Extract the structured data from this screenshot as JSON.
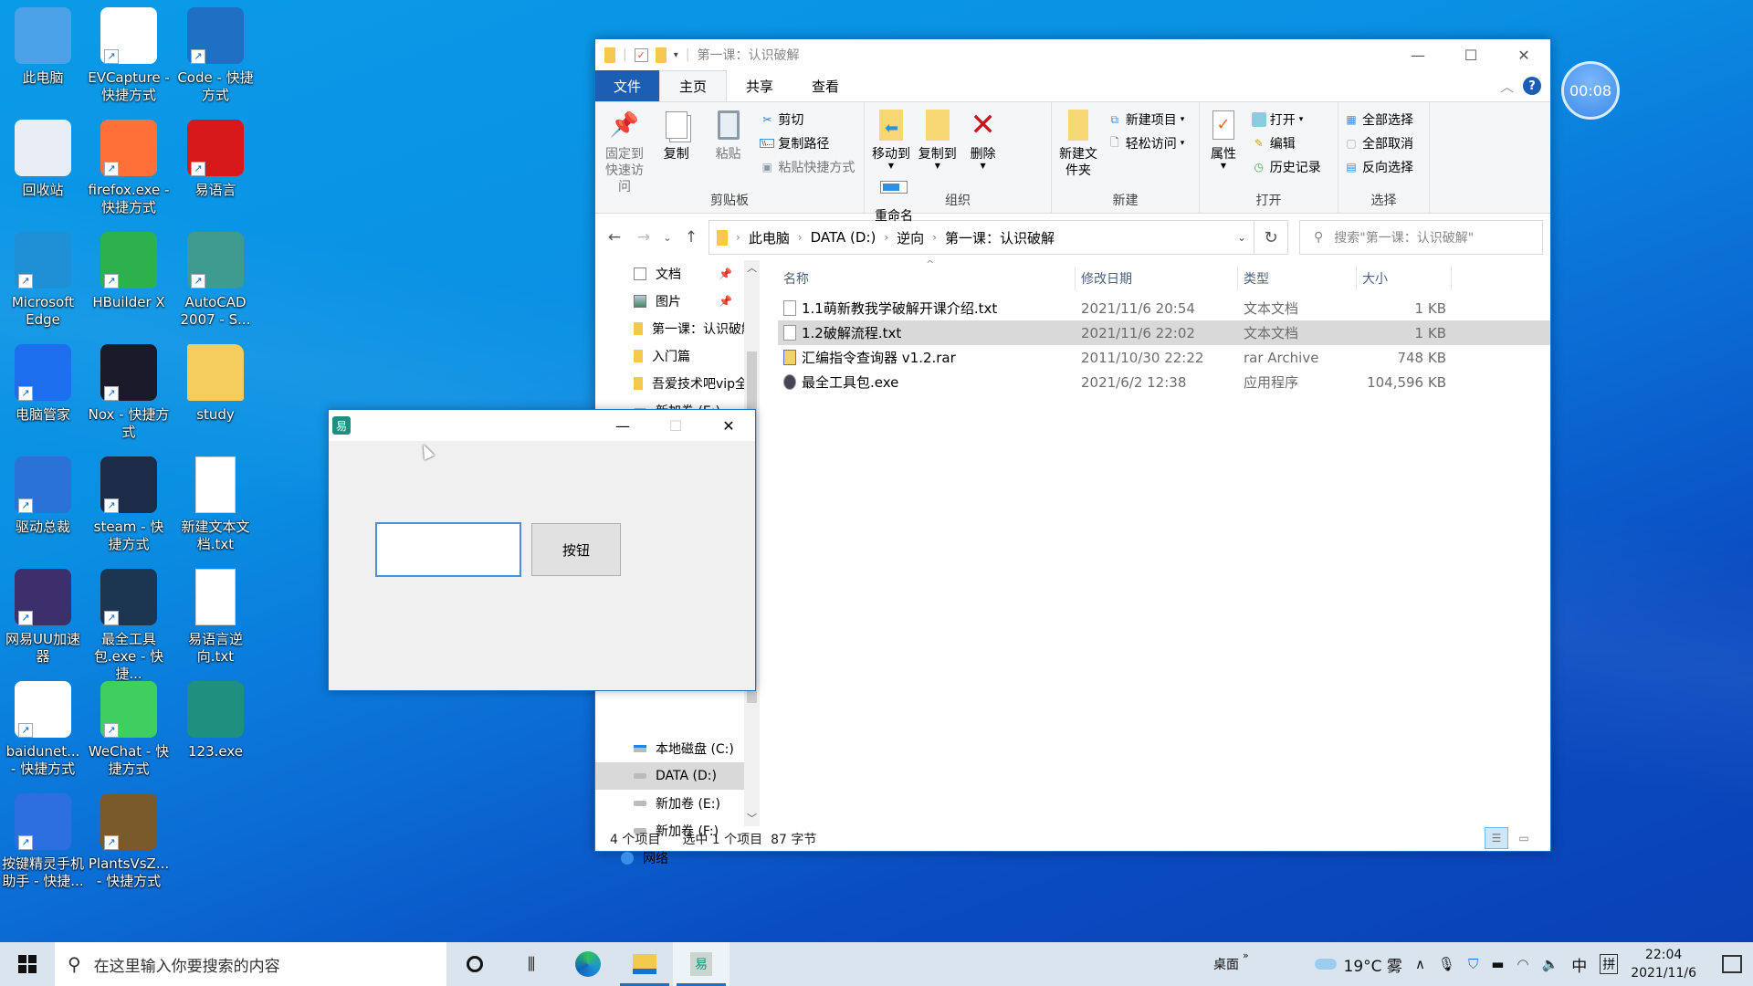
{
  "desktop": {
    "icons": [
      {
        "label": "此电脑",
        "icon": "computer-icon",
        "shortcut": false,
        "color": "#4aa3e8"
      },
      {
        "label": "EVCapture - 快捷方式",
        "icon": "evcapture-icon",
        "shortcut": true,
        "color": "#ffffff"
      },
      {
        "label": "Code - 快捷方式",
        "icon": "vscode-icon",
        "shortcut": true,
        "color": "#1f6fc5"
      },
      {
        "label": "回收站",
        "icon": "recycle-bin-icon",
        "shortcut": false,
        "color": "#e8eef3"
      },
      {
        "label": "firefox.exe - 快捷方式",
        "icon": "firefox-icon",
        "shortcut": true,
        "color": "#ff7139"
      },
      {
        "label": "易语言",
        "icon": "eyuyan-icon",
        "shortcut": true,
        "color": "#d7191c"
      },
      {
        "label": "Microsoft Edge",
        "icon": "edge-icon",
        "shortcut": true,
        "color": "#1f8fd6"
      },
      {
        "label": "HBuilder X",
        "icon": "hbuilder-icon",
        "shortcut": true,
        "color": "#2bb24c"
      },
      {
        "label": "AutoCAD 2007 - S...",
        "icon": "autocad-icon",
        "shortcut": true,
        "color": "#3f9a8f"
      },
      {
        "label": "电脑管家",
        "icon": "tencent-pc-manager-icon",
        "shortcut": true,
        "color": "#1e6ff0"
      },
      {
        "label": "Nox - 快捷方式",
        "icon": "nox-icon",
        "shortcut": true,
        "color": "#1a1a2a"
      },
      {
        "label": "study",
        "icon": "folder-icon",
        "shortcut": false,
        "color": "#f4cd5d"
      },
      {
        "label": "驱动总裁",
        "icon": "driver-icon",
        "shortcut": true,
        "color": "#2a72d6"
      },
      {
        "label": "steam - 快捷方式",
        "icon": "steam-icon",
        "shortcut": true,
        "color": "#1b2b48"
      },
      {
        "label": "新建文本文档.txt",
        "icon": "text-file-icon",
        "shortcut": false,
        "color": "#ffffff"
      },
      {
        "label": "网易UU加速器",
        "icon": "uu-accelerator-icon",
        "shortcut": true,
        "color": "#3d2f6b"
      },
      {
        "label": "最全工具包.exe - 快捷...",
        "icon": "toolkit-icon",
        "shortcut": true,
        "color": "#1c3550"
      },
      {
        "label": "易语言逆向.txt",
        "icon": "text-file-icon",
        "shortcut": false,
        "color": "#ffffff"
      },
      {
        "label": "baidunet... - 快捷方式",
        "icon": "baidu-netdisk-icon",
        "shortcut": true,
        "color": "#ffffff"
      },
      {
        "label": "WeChat - 快捷方式",
        "icon": "wechat-icon",
        "shortcut": true,
        "color": "#3fcf5f"
      },
      {
        "label": "123.exe",
        "icon": "eyuyan-exe-icon",
        "shortcut": false,
        "color": "#1f8f7f"
      },
      {
        "label": "按键精灵手机助手 - 快捷...",
        "icon": "anjian-icon",
        "shortcut": true,
        "color": "#2d6fe0"
      },
      {
        "label": "PlantsVsZ... - 快捷方式",
        "icon": "pvz-icon",
        "shortcut": true,
        "color": "#7a5a2a"
      }
    ]
  },
  "timer": {
    "value": "00:08"
  },
  "explorer": {
    "title": "第一课：认识破解",
    "tabs": [
      {
        "label": "文件"
      },
      {
        "label": "主页"
      },
      {
        "label": "共享"
      },
      {
        "label": "查看"
      }
    ],
    "ribbon": {
      "clipboard": {
        "label": "剪贴板",
        "pin": "固定到快速访问",
        "copy": "复制",
        "paste": "粘贴",
        "cut": "剪切",
        "copy_path": "复制路径",
        "paste_shortcut": "粘贴快捷方式"
      },
      "organize": {
        "label": "组织",
        "move_to": "移动到",
        "copy_to": "复制到",
        "delete": "删除",
        "rename": "重命名"
      },
      "new": {
        "label": "新建",
        "new_folder": "新建文件夹",
        "new_item": "新建项目",
        "easy_access": "轻松访问"
      },
      "open": {
        "label": "打开",
        "properties": "属性",
        "open": "打开",
        "edit": "编辑",
        "history": "历史记录"
      },
      "select": {
        "label": "选择",
        "select_all": "全部选择",
        "select_none": "全部取消",
        "invert": "反向选择"
      }
    },
    "breadcrumb": [
      "此电脑",
      "DATA (D:)",
      "逆向",
      "第一课：认识破解"
    ],
    "search_placeholder": "搜索\"第一课：认识破解\"",
    "nav": [
      {
        "label": "文档",
        "icon": "documents-icon",
        "pinned": true
      },
      {
        "label": "图片",
        "icon": "pictures-icon",
        "pinned": true
      },
      {
        "label": "第一课：认识破解",
        "icon": "folder-icon",
        "pinned": false
      },
      {
        "label": "入门篇",
        "icon": "folder-icon",
        "pinned": false
      },
      {
        "label": "吾爱技术吧vip全",
        "icon": "folder-icon",
        "pinned": false
      },
      {
        "label": "新加卷 (E:)",
        "icon": "drive-icon",
        "pinned": false
      }
    ],
    "nav_drives": [
      {
        "label": "本地磁盘 (C:)",
        "icon": "system-drive-icon",
        "selected": false
      },
      {
        "label": "DATA (D:)",
        "icon": "drive-icon",
        "selected": true
      },
      {
        "label": "新加卷 (E:)",
        "icon": "drive-icon",
        "selected": false
      },
      {
        "label": "新加卷 (F:)",
        "icon": "drive-icon",
        "selected": false
      },
      {
        "label": "网络",
        "icon": "network-icon",
        "selected": false
      }
    ],
    "columns": [
      "名称",
      "修改日期",
      "类型",
      "大小"
    ],
    "files": [
      {
        "name": "1.1萌新教我学破解开课介绍.txt",
        "date": "2021/11/6 20:54",
        "type": "文本文档",
        "size": "1 KB",
        "icon": "text-file-icon",
        "selected": false
      },
      {
        "name": "1.2破解流程.txt",
        "date": "2021/11/6 22:02",
        "type": "文本文档",
        "size": "1 KB",
        "icon": "text-file-icon",
        "selected": true
      },
      {
        "name": "汇编指令查询器 v1.2.rar",
        "date": "2011/10/30 22:22",
        "type": "rar Archive",
        "size": "748 KB",
        "icon": "rar-icon",
        "selected": false
      },
      {
        "name": "最全工具包.exe",
        "date": "2021/6/2 12:38",
        "type": "应用程序",
        "size": "104,596 KB",
        "icon": "exe-icon",
        "selected": false
      }
    ],
    "status": {
      "count": "4 个项目",
      "selection": "选中 1 个项目  87 字节"
    }
  },
  "dialog": {
    "input_value": "",
    "button_label": "按钮"
  },
  "taskbar": {
    "search_placeholder": "在这里输入你要搜索的内容",
    "desktop_label": "桌面",
    "weather": "19°C 雾",
    "ime_lang": "中",
    "ime_mode": "拼",
    "time": "22:04",
    "date": "2021/11/6"
  }
}
